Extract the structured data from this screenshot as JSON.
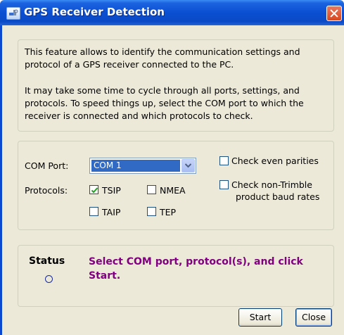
{
  "window": {
    "title": "GPS Receiver Detection"
  },
  "intro": {
    "paragraph1": "This feature allows to identify the communication settings and protocol of a GPS receiver connected to the PC.",
    "paragraph2": "It may take some time to cycle through all ports, settings, and protocols. To speed things up, select the COM port to which the receiver is connected and which protocols to check."
  },
  "settings": {
    "com_port_label": "COM Port:",
    "com_port_value": "COM 1",
    "protocols_label": "Protocols:",
    "protocols": [
      {
        "label": "TSIP",
        "checked": true
      },
      {
        "label": "NMEA",
        "checked": false
      },
      {
        "label": "TAIP",
        "checked": false
      },
      {
        "label": "TEP",
        "checked": false
      }
    ],
    "check_even_parities": {
      "label": "Check even parities",
      "checked": false
    },
    "check_non_trimble": {
      "label_line1": "Check non-Trimble",
      "label_line2": "product baud rates",
      "checked": false
    }
  },
  "status": {
    "label": "Status",
    "message": "Select COM port, protocol(s), and click Start.",
    "message_color": "#800080"
  },
  "buttons": {
    "start": "Start",
    "close": "Close"
  },
  "icons": {
    "app": "satellite-icon",
    "close": "close-icon",
    "dropdown": "chevron-down-icon",
    "status": "status-indicator-icon"
  }
}
